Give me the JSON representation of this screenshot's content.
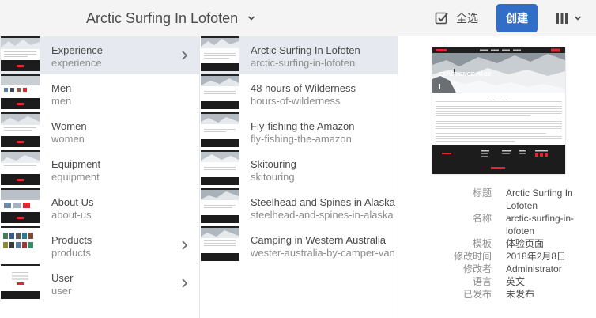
{
  "header": {
    "title": "Arctic Surfing In Lofoten",
    "select_all_label": "全选",
    "create_label": "创建"
  },
  "column1": {
    "items": [
      {
        "title": "Experience",
        "name": "experience",
        "has_children": true,
        "selected": true
      },
      {
        "title": "Men",
        "name": "men",
        "has_children": false
      },
      {
        "title": "Women",
        "name": "women",
        "has_children": false
      },
      {
        "title": "Equipment",
        "name": "equipment",
        "has_children": false
      },
      {
        "title": "About Us",
        "name": "about-us",
        "has_children": false
      },
      {
        "title": "Products",
        "name": "products",
        "has_children": true
      },
      {
        "title": "User",
        "name": "user",
        "has_children": true
      }
    ]
  },
  "column2": {
    "items": [
      {
        "title": "Arctic Surfing In Lofoten",
        "name": "arctic-surfing-in-lofoten",
        "selected": true
      },
      {
        "title": "48 hours of Wilderness",
        "name": "hours-of-wilderness"
      },
      {
        "title": "Fly-fishing the Amazon",
        "name": "fly-fishing-the-amazon"
      },
      {
        "title": "Skitouring",
        "name": "skitouring"
      },
      {
        "title": "Steelhead and Spines in Alaska",
        "name": "steelhead-and-spines-in-alaska"
      },
      {
        "title": "Camping in Western Australia",
        "name": "wester-australia-by-camper-van"
      }
    ]
  },
  "details": {
    "preview_banner_text": "EXPERIENCE PAGE",
    "rows": [
      {
        "key": "标题",
        "value": "Arctic Surfing In Lofoten"
      },
      {
        "key": "名称",
        "value": "arctic-surfing-in-lofoten"
      },
      {
        "key": "模板",
        "value": "体验页面"
      },
      {
        "key": "修改时间",
        "value": "2018年2月8日"
      },
      {
        "key": "修改者",
        "value": "Administrator"
      },
      {
        "key": "语言",
        "value": "英文"
      },
      {
        "key": "已发布",
        "value": "未发布"
      }
    ]
  },
  "colors": {
    "accent": "#326ec8",
    "selected_row": "#e6eaf0",
    "topbar": "#f4f4f4",
    "brand_red": "#e3262f"
  },
  "icons": {
    "title_chevron": "chevron-down-icon",
    "select_all": "checkbox-checked-icon",
    "view_switch": "column-view-icon",
    "row_chevron": "chevron-right-icon"
  }
}
